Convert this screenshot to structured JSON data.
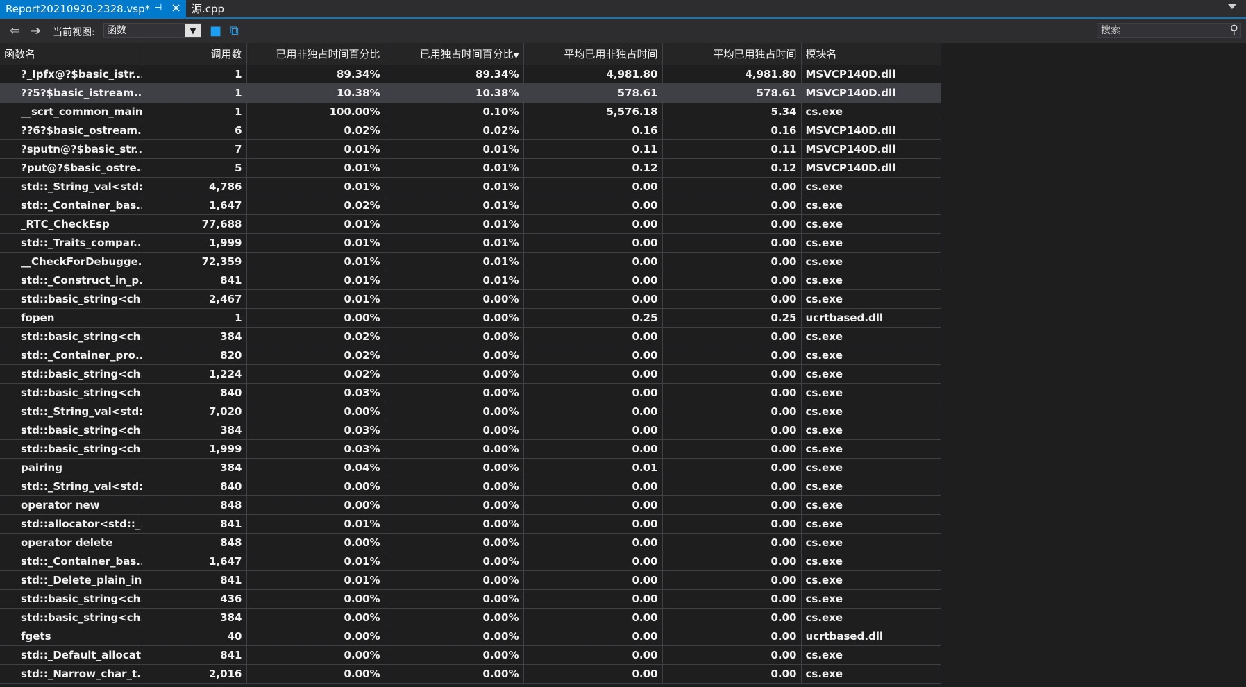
{
  "tabs": [
    {
      "label": "Report20210920-2328.vsp*",
      "pin_icon": "pin-icon",
      "close_icon": "close-icon"
    },
    {
      "label": "源.cpp"
    }
  ],
  "toolbar": {
    "current_view_label": "当前视图:",
    "current_view_value": "函数",
    "search_placeholder": "搜索"
  },
  "table": {
    "columns": [
      "函数名",
      "调用数",
      "已用非独占时间百分比",
      "已用独占时间百分比",
      "平均已用非独占时间",
      "平均已用独占时间",
      "模块名"
    ],
    "sort_column": 3,
    "sort_direction": "descending",
    "selected_row": 1,
    "rows": [
      [
        "?_Ipfx@?$basic_istr...",
        "1",
        "89.34%",
        "89.34%",
        "4,981.80",
        "4,981.80",
        "MSVCP140D.dll"
      ],
      [
        "??5?$basic_istream...",
        "1",
        "10.38%",
        "10.38%",
        "578.61",
        "578.61",
        "MSVCP140D.dll"
      ],
      [
        "__scrt_common_main",
        "1",
        "100.00%",
        "0.10%",
        "5,576.18",
        "5.34",
        "cs.exe"
      ],
      [
        "??6?$basic_ostream...",
        "6",
        "0.02%",
        "0.02%",
        "0.16",
        "0.16",
        "MSVCP140D.dll"
      ],
      [
        "?sputn@?$basic_str...",
        "7",
        "0.01%",
        "0.01%",
        "0.11",
        "0.11",
        "MSVCP140D.dll"
      ],
      [
        "?put@?$basic_ostre...",
        "5",
        "0.01%",
        "0.01%",
        "0.12",
        "0.12",
        "MSVCP140D.dll"
      ],
      [
        "std::_String_val<std:...",
        "4,786",
        "0.01%",
        "0.01%",
        "0.00",
        "0.00",
        "cs.exe"
      ],
      [
        "std::_Container_bas...",
        "1,647",
        "0.02%",
        "0.01%",
        "0.00",
        "0.00",
        "cs.exe"
      ],
      [
        "_RTC_CheckEsp",
        "77,688",
        "0.01%",
        "0.01%",
        "0.00",
        "0.00",
        "cs.exe"
      ],
      [
        "std::_Traits_compar...",
        "1,999",
        "0.01%",
        "0.01%",
        "0.00",
        "0.00",
        "cs.exe"
      ],
      [
        "__CheckForDebugge...",
        "72,359",
        "0.01%",
        "0.01%",
        "0.00",
        "0.00",
        "cs.exe"
      ],
      [
        "std::_Construct_in_p...",
        "841",
        "0.01%",
        "0.01%",
        "0.00",
        "0.00",
        "cs.exe"
      ],
      [
        "std::basic_string<ch...",
        "2,467",
        "0.01%",
        "0.00%",
        "0.00",
        "0.00",
        "cs.exe"
      ],
      [
        "fopen",
        "1",
        "0.00%",
        "0.00%",
        "0.25",
        "0.25",
        "ucrtbased.dll"
      ],
      [
        "std::basic_string<ch...",
        "384",
        "0.02%",
        "0.00%",
        "0.00",
        "0.00",
        "cs.exe"
      ],
      [
        "std::_Container_pro...",
        "820",
        "0.02%",
        "0.00%",
        "0.00",
        "0.00",
        "cs.exe"
      ],
      [
        "std::basic_string<ch...",
        "1,224",
        "0.02%",
        "0.00%",
        "0.00",
        "0.00",
        "cs.exe"
      ],
      [
        "std::basic_string<ch...",
        "840",
        "0.03%",
        "0.00%",
        "0.00",
        "0.00",
        "cs.exe"
      ],
      [
        "std::_String_val<std:...",
        "7,020",
        "0.00%",
        "0.00%",
        "0.00",
        "0.00",
        "cs.exe"
      ],
      [
        "std::basic_string<ch...",
        "384",
        "0.03%",
        "0.00%",
        "0.00",
        "0.00",
        "cs.exe"
      ],
      [
        "std::basic_string<ch...",
        "1,999",
        "0.03%",
        "0.00%",
        "0.00",
        "0.00",
        "cs.exe"
      ],
      [
        "pairing",
        "384",
        "0.04%",
        "0.00%",
        "0.01",
        "0.00",
        "cs.exe"
      ],
      [
        "std::_String_val<std:...",
        "840",
        "0.00%",
        "0.00%",
        "0.00",
        "0.00",
        "cs.exe"
      ],
      [
        "operator new",
        "848",
        "0.00%",
        "0.00%",
        "0.00",
        "0.00",
        "cs.exe"
      ],
      [
        "std::allocator<std::_...",
        "841",
        "0.01%",
        "0.00%",
        "0.00",
        "0.00",
        "cs.exe"
      ],
      [
        "operator delete",
        "848",
        "0.00%",
        "0.00%",
        "0.00",
        "0.00",
        "cs.exe"
      ],
      [
        "std::_Container_bas...",
        "1,647",
        "0.01%",
        "0.00%",
        "0.00",
        "0.00",
        "cs.exe"
      ],
      [
        "std::_Delete_plain_in...",
        "841",
        "0.01%",
        "0.00%",
        "0.00",
        "0.00",
        "cs.exe"
      ],
      [
        "std::basic_string<ch...",
        "436",
        "0.00%",
        "0.00%",
        "0.00",
        "0.00",
        "cs.exe"
      ],
      [
        "std::basic_string<ch...",
        "384",
        "0.00%",
        "0.00%",
        "0.00",
        "0.00",
        "cs.exe"
      ],
      [
        "fgets",
        "40",
        "0.00%",
        "0.00%",
        "0.00",
        "0.00",
        "ucrtbased.dll"
      ],
      [
        "std::_Default_allocat...",
        "841",
        "0.00%",
        "0.00%",
        "0.00",
        "0.00",
        "cs.exe"
      ],
      [
        "std::_Narrow_char_t...",
        "2,016",
        "0.00%",
        "0.00%",
        "0.00",
        "0.00",
        "cs.exe"
      ]
    ]
  },
  "colors": {
    "accent": "#007acc",
    "background": "#1e1e1e",
    "selected_row": "#3f3f46"
  }
}
